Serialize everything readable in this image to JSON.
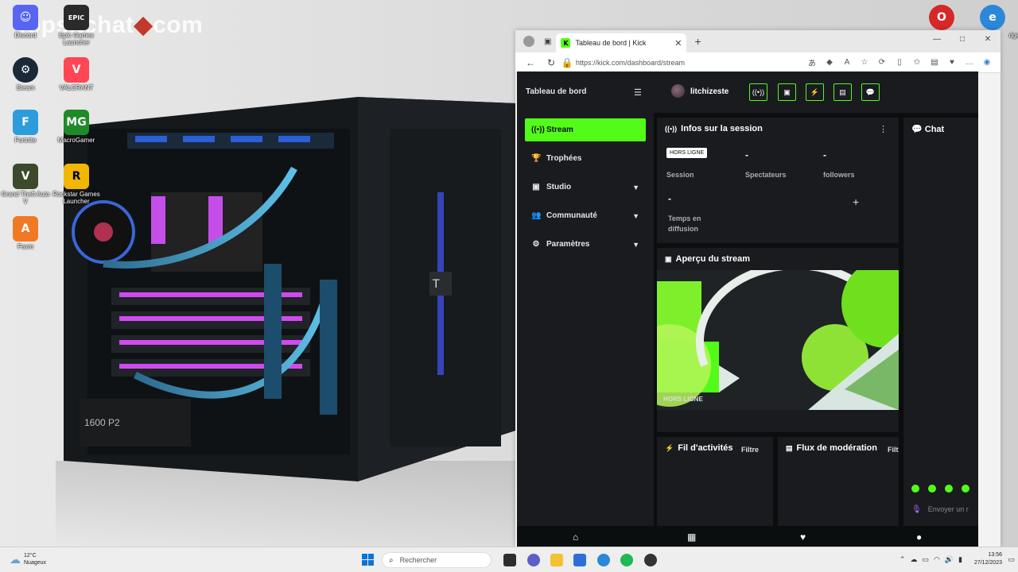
{
  "desktop": {
    "watermark": "lopsachat",
    "watermark_suffix": "com",
    "icons": [
      {
        "label": "Discord",
        "icon": "discord-icon",
        "color": "#5865f2"
      },
      {
        "label": "Epic Games Launcher",
        "icon": "epic-games-icon",
        "color": "#2a2a2a"
      },
      {
        "label": "Steam",
        "icon": "steam-icon",
        "color": "#1b2838"
      },
      {
        "label": "VALORANT",
        "icon": "valorant-icon",
        "color": "#ff4655"
      },
      {
        "label": "Fortnite",
        "icon": "fortnite-icon",
        "color": "#2d9cdb"
      },
      {
        "label": "MacroGamer",
        "icon": "macrogamer-icon",
        "color": "#1f8a28"
      },
      {
        "label": "Grand Theft Auto V",
        "icon": "gta5-icon",
        "color": "#3a4a2a"
      },
      {
        "label": "Rockstar Games Launcher",
        "icon": "rockstar-icon",
        "color": "#f2b705"
      },
      {
        "label": "Faxm",
        "icon": "faxm-icon",
        "color": "#f07a24"
      }
    ],
    "right_icons": [
      {
        "label": "",
        "icon": "opera-gx-icon",
        "color": "#d62828"
      },
      {
        "label": "dge",
        "icon": "edge-icon",
        "color": "#2b88d8"
      }
    ]
  },
  "browser": {
    "tab_title": "Tableau de bord | Kick",
    "url": "https://kick.com/dashboard/stream",
    "window_controls": [
      "—",
      "□",
      "✕"
    ]
  },
  "kick": {
    "sidebar_title": "Tableau de bord",
    "nav": [
      {
        "label": "Stream",
        "icon": "broadcast-icon",
        "active": true
      },
      {
        "label": "Trophées",
        "icon": "trophy-icon"
      },
      {
        "label": "Studio",
        "icon": "studio-icon",
        "expandable": true
      },
      {
        "label": "Communauté",
        "icon": "community-icon",
        "expandable": true
      },
      {
        "label": "Paramètres",
        "icon": "settings-icon",
        "expandable": true
      }
    ],
    "username": "litchizeste",
    "session": {
      "title": "Infos sur la session",
      "badge": "HORS LIGNE",
      "stats": [
        {
          "value": "",
          "label": "Session"
        },
        {
          "value": "-",
          "label": "Spectateurs"
        },
        {
          "value": "-",
          "label": "followers"
        },
        {
          "value": "-",
          "label": "Temps en diffusion"
        }
      ]
    },
    "preview": {
      "title": "Aperçu du stream",
      "status": "HORS LIGNE"
    },
    "activity": {
      "title": "Fil d'activités",
      "filter": "Filtre"
    },
    "moderation": {
      "title": "Flux de modération",
      "filter": "Filt"
    },
    "chat": {
      "title": "Chat",
      "placeholder": "Envoyer un r"
    },
    "accent": "#53fc18"
  },
  "taskbar": {
    "temp": "12°C",
    "weather": "Nuageux",
    "search_placeholder": "Rechercher",
    "time": "13:56",
    "date": "27/12/2023"
  }
}
